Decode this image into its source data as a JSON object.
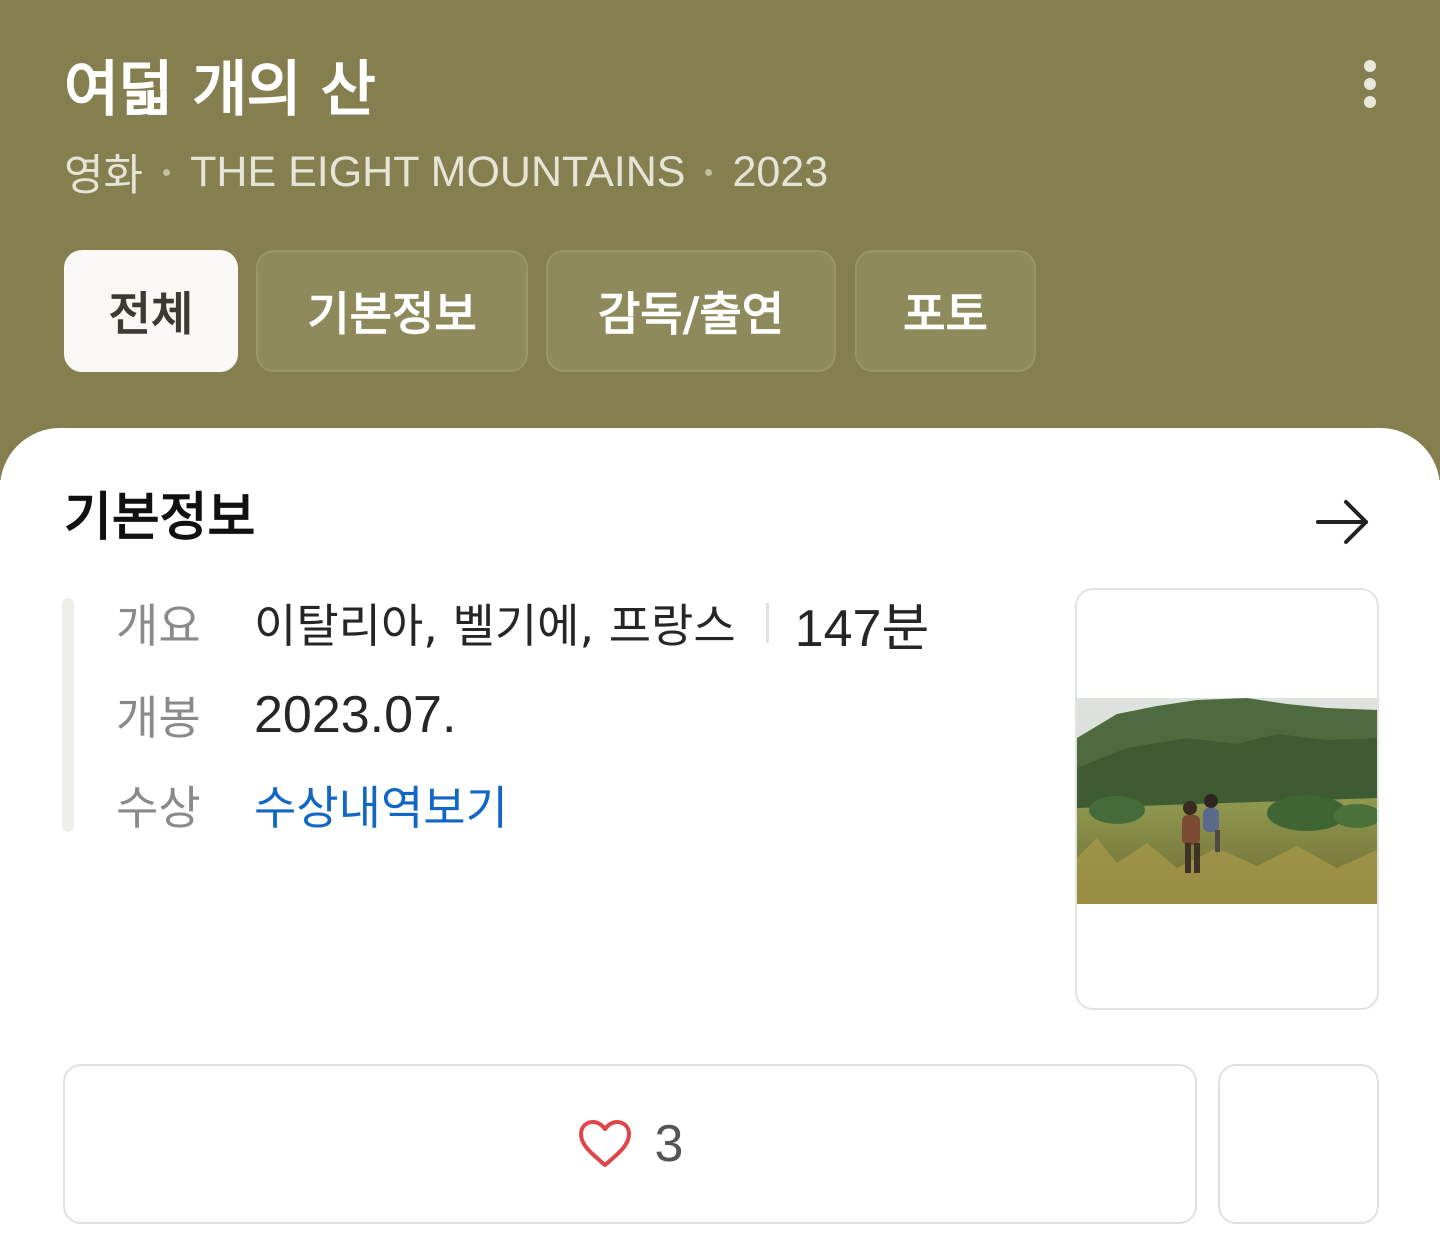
{
  "header": {
    "title": "여덟 개의 산",
    "category": "영화",
    "original_title": "THE EIGHT MOUNTAINS",
    "year": "2023",
    "background_color": "#857f50",
    "more_icon": "more-vertical-icon"
  },
  "tabs": [
    {
      "label": "전체",
      "active": true
    },
    {
      "label": "기본정보",
      "active": false
    },
    {
      "label": "감독/출연",
      "active": false
    },
    {
      "label": "포토",
      "active": false
    }
  ],
  "basic_info": {
    "title": "기본정보",
    "arrow_icon": "arrow-right-icon",
    "overview_label": "개요",
    "overview_value": "이탈리아, 벨기에, 프랑스",
    "runtime": "147분",
    "release_label": "개봉",
    "release_value": "2023.07.",
    "awards_label": "수상",
    "awards_link": "수상내역보기",
    "link_color": "#1167c3"
  },
  "poster": {
    "icon": "movie-still-image"
  },
  "actions": {
    "like_icon": "heart-outline-icon",
    "like_count": "3",
    "like_color": "#e0454a"
  }
}
